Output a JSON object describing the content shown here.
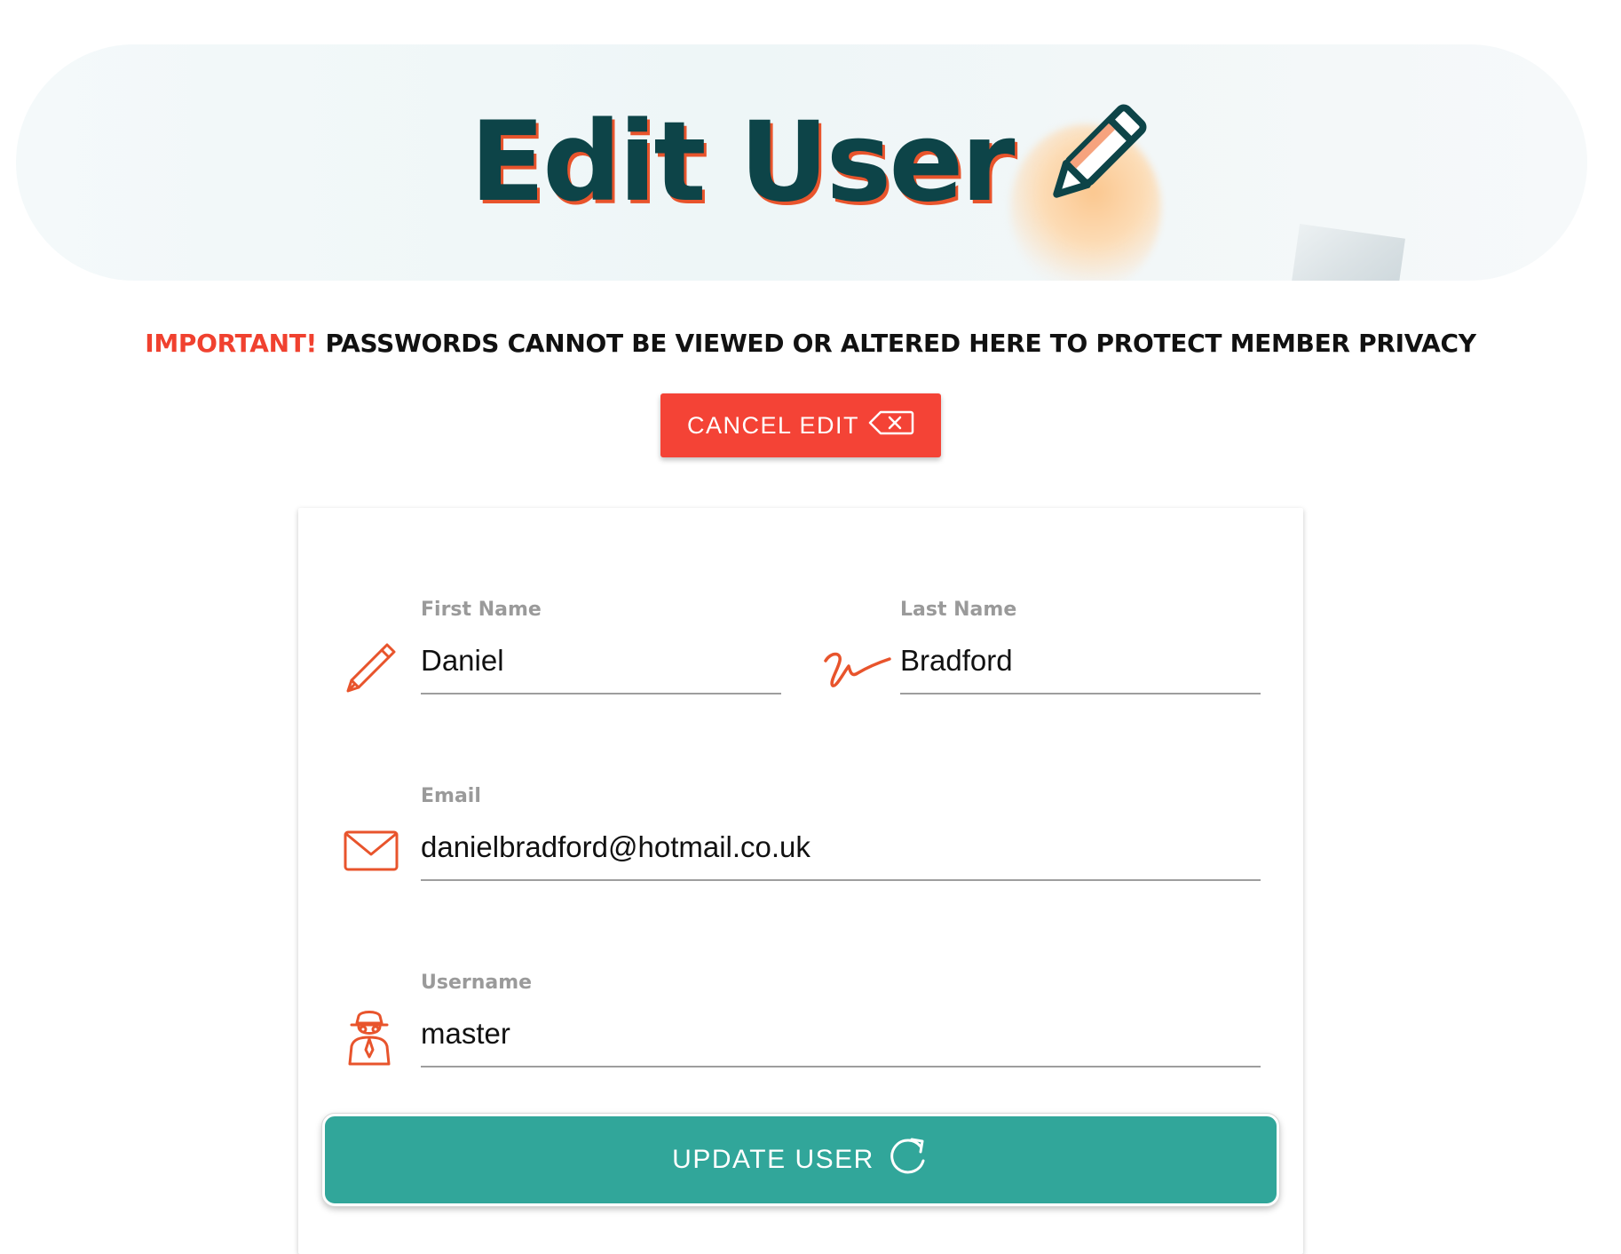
{
  "header": {
    "title": "Edit User",
    "title_icon": "pencil-icon"
  },
  "notice": {
    "important": "IMPORTANT!",
    "message": " PASSWORDS CANNOT BE VIEWED OR ALTERED HERE TO PROTECT MEMBER PRIVACY"
  },
  "cancel_button": {
    "label": "CANCEL EDIT",
    "icon": "backspace-icon",
    "color": "#f44336"
  },
  "form": {
    "first_name": {
      "label": "First Name",
      "value": "Daniel",
      "icon": "pencil-icon"
    },
    "last_name": {
      "label": "Last Name",
      "value": "Bradford",
      "icon": "signature-icon"
    },
    "email": {
      "label": "Email",
      "value": "danielbradford@hotmail.co.uk",
      "icon": "envelope-icon"
    },
    "username": {
      "label": "Username",
      "value": "master",
      "icon": "spy-icon"
    },
    "accent_color": "#e8542c"
  },
  "update_button": {
    "label": "UPDATE USER",
    "icon": "refresh-icon",
    "color": "#31a69a"
  },
  "colors": {
    "title": "#0d4448",
    "title_shadow": "#e8542c",
    "important": "#f0412f"
  }
}
